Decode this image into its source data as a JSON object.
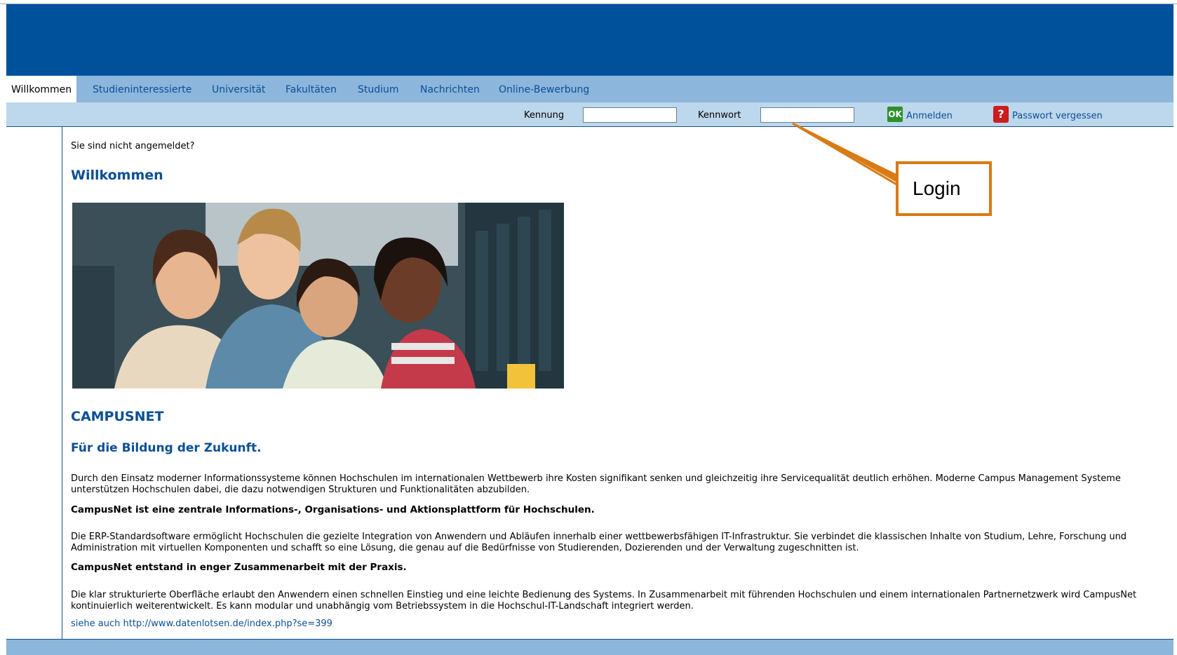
{
  "nav": {
    "tabs": [
      {
        "label": "Willkommen",
        "active": true
      },
      {
        "label": "Studieninteressierte"
      },
      {
        "label": "Universität"
      },
      {
        "label": "Fakultäten"
      },
      {
        "label": "Studium"
      },
      {
        "label": "Nachrichten"
      },
      {
        "label": "Online-Bewerbung"
      }
    ]
  },
  "login_bar": {
    "username_label": "Kennung",
    "username_value": "",
    "password_label": "Kennwort",
    "password_value": "",
    "submit_icon": "OK",
    "submit_label": "Anmelden",
    "forgot_icon": "?",
    "forgot_label": "Passwort vergessen"
  },
  "content": {
    "status": "Sie sind nicht angemeldet?",
    "welcome_title": "Willkommen",
    "brand_title": "CAMPUSNET",
    "tagline": "Für die Bildung der Zukunft.",
    "para1": "Durch den Einsatz moderner Informationssysteme können Hochschulen im internationalen Wettbewerb ihre Kosten signifikant senken und gleichzeitig ihre Servicequalität deutlich erhöhen. Moderne Campus Management Systeme unterstützen Hochschulen dabei, die dazu notwendigen Strukturen und Funktionalitäten abzubilden.",
    "bold1": "CampusNet ist eine zentrale Informations-, Organisations- und Aktionsplattform für Hochschulen.",
    "para2": "Die ERP-Standardsoftware ermöglicht Hochschulen die gezielte Integration von Anwendern und Abläufen innerhalb einer wettbewerbsfähigen IT-Infrastruktur. Sie verbindet die klassischen Inhalte von Studium, Lehre, Forschung und Administration mit virtuellen Komponenten und schafft so eine Lösung, die genau auf die Bedürfnisse von Studierenden, Dozierenden und der Verwaltung zugeschnitten ist.",
    "bold2": "CampusNet entstand in enger Zusammenarbeit mit der Praxis.",
    "para3": "Die klar strukturierte Oberfläche erlaubt den Anwendern einen schnellen Einstieg und eine leichte Bedienung des Systems. In Zusammenarbeit mit führenden Hochschulen und einem internationalen Partnernetzwerk wird CampusNet kontinuierlich weiterentwickelt. Es kann modular und unabhängig vom Betriebssystem in die Hochschul-IT-Landschaft integriert werden.",
    "see_also": "siehe auch http://www.datenlotsen.de/index.php?se=399"
  },
  "annotation": {
    "label": "Login",
    "color": "#d97a14"
  },
  "colors": {
    "header": "#00519c",
    "nav": "#8cb6dc",
    "login_bar": "#bdd7ec",
    "link": "#0b4f95"
  }
}
